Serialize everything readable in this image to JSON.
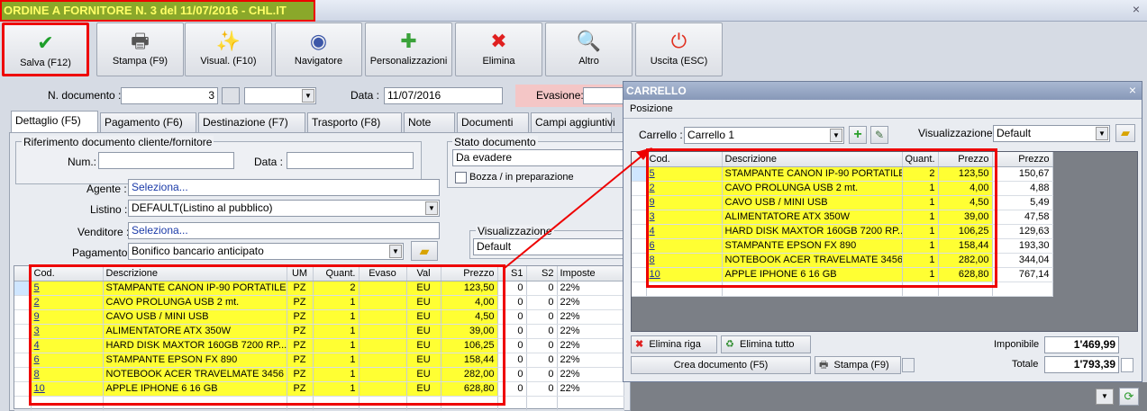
{
  "window": {
    "title": "ORDINE A FORNITORE N. 3 del 11/07/2016 - CHL.IT",
    "close": "×"
  },
  "toolbar": [
    {
      "label": "Salva (F12)",
      "icon": "check-icon",
      "glyph": "✔",
      "color": "#1e9e2a"
    },
    {
      "label": "Stampa (F9)",
      "icon": "printer-icon",
      "glyph": "🖶",
      "color": "#555555"
    },
    {
      "label": "Visual. (F10)",
      "icon": "magic-wand-icon",
      "glyph": "✨",
      "color": "#c28a00"
    },
    {
      "label": "Navigatore",
      "icon": "compass-icon",
      "glyph": "◉",
      "color": "#3c57a8"
    },
    {
      "label": "Personalizzazioni",
      "icon": "puzzle-icon",
      "glyph": "✚",
      "color": "#3aa23a"
    },
    {
      "label": "Elimina",
      "icon": "delete-x-icon",
      "glyph": "✖",
      "color": "#e02020"
    },
    {
      "label": "Altro",
      "icon": "magnifier-icon",
      "glyph": "🔍",
      "color": "#2a6fd0"
    },
    {
      "label": "Uscita (ESC)",
      "icon": "power-icon",
      "glyph": "⏻",
      "color": "#e03020"
    }
  ],
  "header": {
    "doc_label": "N. documento :",
    "doc_value": "3",
    "date_label": "Data :",
    "date_value": "11/07/2016",
    "evasione_label": "Evasione:"
  },
  "tabs": [
    "Dettaglio (F5)",
    "Pagamento (F6)",
    "Destinazione (F7)",
    "Trasporto (F8)",
    "Note",
    "Documenti",
    "Campi aggiuntivi"
  ],
  "riferimento": {
    "title": "Riferimento documento cliente/fornitore",
    "num_label": "Num.:",
    "data_label": "Data :"
  },
  "stato": {
    "title": "Stato documento",
    "value": "Da evadere",
    "bozza": "Bozza / in preparazione"
  },
  "form": {
    "agente_label": "Agente :",
    "agente_value": "Seleziona...",
    "listino_label": "Listino :",
    "listino_value": "DEFAULT(Listino al pubblico)",
    "venditore_label": "Venditore :",
    "venditore_value": "Seleziona...",
    "pagamento_label": "Pagamento :",
    "pagamento_value": "Bonifico bancario anticipato",
    "visualizzazione_label": "Visualizzazione",
    "visualizzazione_value": "Default"
  },
  "main_table": {
    "headers": [
      "Cod.",
      "Descrizione",
      "UM",
      "Quant.",
      "Evaso",
      "Val",
      "Prezzo",
      "S1",
      "S2",
      "Imposte"
    ],
    "rows": [
      [
        "5",
        "STAMPANTE CANON IP-90 PORTATILE",
        "PZ",
        "2",
        "",
        "EU",
        "123,50",
        "0",
        "0",
        "22%"
      ],
      [
        "2",
        "CAVO PROLUNGA USB 2 mt.",
        "PZ",
        "1",
        "",
        "EU",
        "4,00",
        "0",
        "0",
        "22%"
      ],
      [
        "9",
        "CAVO USB / MINI USB",
        "PZ",
        "1",
        "",
        "EU",
        "4,50",
        "0",
        "0",
        "22%"
      ],
      [
        "3",
        "ALIMENTATORE ATX 350W",
        "PZ",
        "1",
        "",
        "EU",
        "39,00",
        "0",
        "0",
        "22%"
      ],
      [
        "4",
        "HARD DISK MAXTOR 160GB 7200 RP...",
        "PZ",
        "1",
        "",
        "EU",
        "106,25",
        "0",
        "0",
        "22%"
      ],
      [
        "6",
        "STAMPANTE EPSON FX 890",
        "PZ",
        "1",
        "",
        "EU",
        "158,44",
        "0",
        "0",
        "22%"
      ],
      [
        "8",
        "NOTEBOOK ACER TRAVELMATE 3456",
        "PZ",
        "1",
        "",
        "EU",
        "282,00",
        "0",
        "0",
        "22%"
      ],
      [
        "10",
        "APPLE IPHONE 6 16 GB",
        "PZ",
        "1",
        "",
        "EU",
        "628,80",
        "0",
        "0",
        "22%"
      ]
    ]
  },
  "cart": {
    "title": "CARRELLO",
    "close": "×",
    "menu": "Posizione",
    "carrello_label": "Carrello :",
    "carrello_value": "Carrello 1",
    "vis_label": "Visualizzazione :",
    "vis_value": "Default",
    "headers": [
      "Cod.",
      "Descrizione",
      "Quant.",
      "Prezzo",
      "Prezzo"
    ],
    "rows": [
      [
        "5",
        "STAMPANTE CANON IP-90 PORTATILE",
        "2",
        "123,50",
        "150,67"
      ],
      [
        "2",
        "CAVO PROLUNGA USB 2 mt.",
        "1",
        "4,00",
        "4,88"
      ],
      [
        "9",
        "CAVO USB / MINI USB",
        "1",
        "4,50",
        "5,49"
      ],
      [
        "3",
        "ALIMENTATORE ATX 350W",
        "1",
        "39,00",
        "47,58"
      ],
      [
        "4",
        "HARD DISK MAXTOR 160GB 7200 RP...",
        "1",
        "106,25",
        "129,63"
      ],
      [
        "6",
        "STAMPANTE EPSON FX 890",
        "1",
        "158,44",
        "193,30"
      ],
      [
        "8",
        "NOTEBOOK ACER TRAVELMATE 3456",
        "1",
        "282,00",
        "344,04"
      ],
      [
        "10",
        "APPLE IPHONE 6 16 GB",
        "1",
        "628,80",
        "767,14"
      ]
    ],
    "elimina_riga": "Elimina riga",
    "elimina_tutto": "Elimina tutto",
    "crea_documento": "Crea documento (F5)",
    "stampa": "Stampa (F9)",
    "imponibile_label": "Imponibile",
    "imponibile_value": "1'469,99",
    "totale_label": "Totale",
    "totale_value": "1'793,39"
  },
  "colors": {
    "highlight": "#ffff33",
    "annotation": "#e00000",
    "title_bg": "#8aa82a"
  }
}
